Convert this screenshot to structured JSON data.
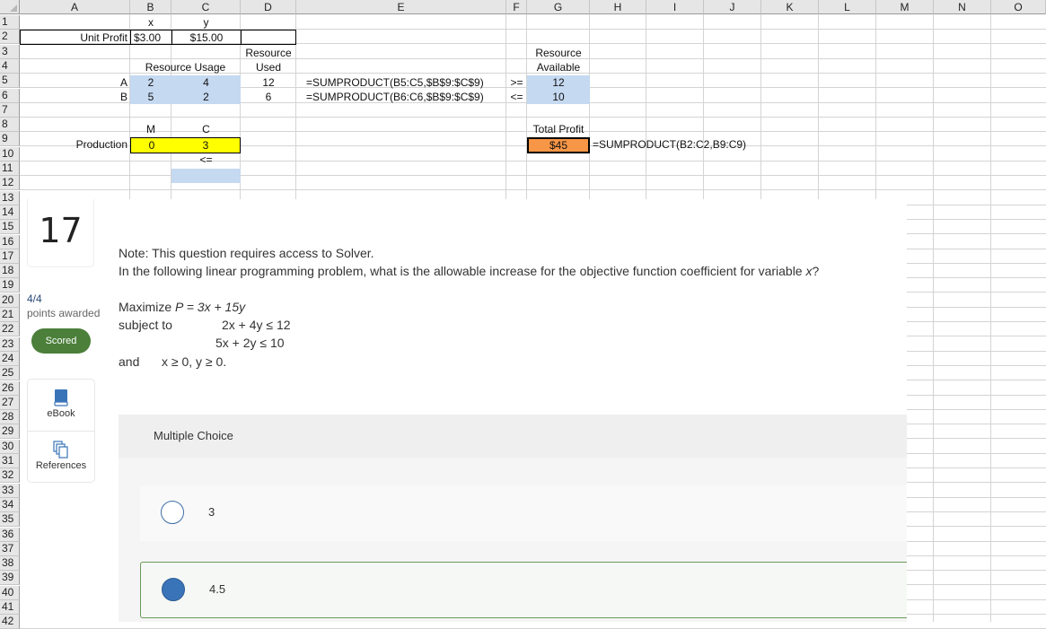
{
  "spreadsheet": {
    "columns": [
      "A",
      "B",
      "C",
      "D",
      "E",
      "F",
      "G",
      "H",
      "I",
      "J",
      "K",
      "L",
      "M",
      "N",
      "O"
    ],
    "rows": [
      "1",
      "2",
      "3",
      "4",
      "5",
      "6",
      "7",
      "8",
      "9",
      "10",
      "11",
      "12",
      "13",
      "14",
      "15",
      "16",
      "17",
      "18",
      "19",
      "20",
      "21",
      "22",
      "23",
      "24",
      "25",
      "26",
      "27",
      "28",
      "29",
      "30",
      "31",
      "32",
      "33",
      "34",
      "35",
      "36",
      "37",
      "38",
      "39",
      "40",
      "41",
      "42"
    ],
    "cells": {
      "B1": "x",
      "C1": "y",
      "A2": "Unit Profit",
      "B2": "$3.00",
      "C2": "$15.00",
      "D3": "Resource",
      "G3": "Resource",
      "B4": "Resource Usage",
      "D4": "Used",
      "G4": "Available",
      "A5": "A",
      "B5": "2",
      "C5": "4",
      "D5": "12",
      "E5": "=SUMPRODUCT(B5:C5,$B$9:$C$9)",
      "F5": ">=",
      "G5": "12",
      "A6": "B",
      "B6": "5",
      "C6": "2",
      "D6": "6",
      "E6": "=SUMPRODUCT(B6:C6,$B$9:$C$9)",
      "F6": "<=",
      "G6": "10",
      "B8": "M",
      "C8": "C",
      "G8": "Total Profit",
      "A9": "Production",
      "B9": "0",
      "C9": "3",
      "G9": "$45",
      "H9": "=SUMPRODUCT(B2:C2,B9:C9)",
      "C10": "<="
    },
    "colors": {
      "input_blue": "#c5d9f1",
      "decision_yellow": "#ffff00",
      "objective_orange": "#f79646"
    }
  },
  "quiz": {
    "question_number": "17",
    "points": "4/4",
    "points_label": "points awarded",
    "status_badge": "Scored",
    "tools": [
      {
        "label": "eBook",
        "icon": "book-icon"
      },
      {
        "label": "References",
        "icon": "copy-pages-icon"
      }
    ],
    "note": "Note: This question requires access to Solver.",
    "question": "In the following linear programming problem, what is the allowable increase for the objective function coefficient for variable ",
    "question_var": "x",
    "question_end": "?",
    "problem": {
      "objective_label": "Maximize",
      "objective": "P = 3x + 15y",
      "subject_to_label": "subject to",
      "constraints": [
        "2x + 4y ≤ 12",
        "5x + 2y ≤ 10"
      ],
      "and_label": "and",
      "nonneg": "x ≥ 0, y ≥ 0."
    },
    "answer_type": "Multiple Choice",
    "options": [
      {
        "label": "3",
        "selected": false
      },
      {
        "label": "4.5",
        "selected": true
      }
    ],
    "colors": {
      "scored_green": "#4b7f3a",
      "radio_blue": "#3a74b8",
      "selected_border": "#6b9a5b"
    }
  }
}
